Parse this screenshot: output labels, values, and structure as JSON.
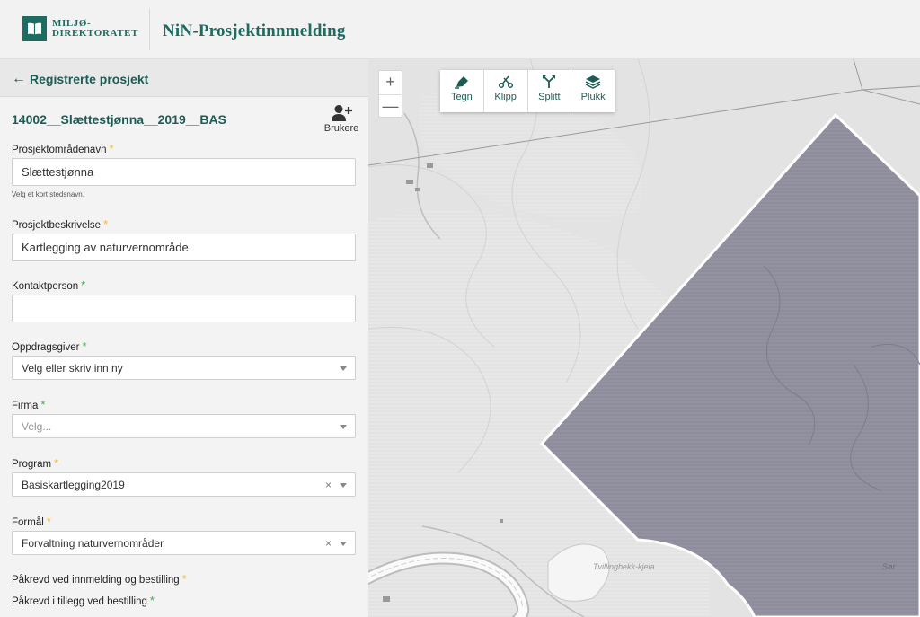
{
  "header": {
    "logo_line1": "MILJØ-",
    "logo_line2": "DIREKTORATET",
    "title": "NiN-Prosjektinnmelding"
  },
  "panel": {
    "back_label": "Registrerte prosjekt",
    "project_title": "14002__Slættestjønna__2019__BAS",
    "users_label": "Brukere",
    "fields": {
      "area_name": {
        "label": "Prosjektområdenavn",
        "value": "Slættestjønna",
        "hint": "Velg et kort stedsnavn."
      },
      "description": {
        "label": "Prosjektbeskrivelse",
        "value": "Kartlegging av naturvernområde"
      },
      "contact": {
        "label": "Kontaktperson",
        "value": ""
      },
      "client": {
        "label": "Oppdragsgiver",
        "value": "Velg eller skriv inn ny"
      },
      "company": {
        "label": "Firma",
        "placeholder": "Velg..."
      },
      "program": {
        "label": "Program",
        "value": "Basiskartlegging2019"
      },
      "purpose": {
        "label": "Formål",
        "value": "Forvaltning naturvernområder"
      }
    },
    "legend_required_registration": "Påkrevd ved innmelding og bestilling",
    "legend_required_ordering": "Påkrevd i tillegg ved bestilling",
    "clear_symbol": "×"
  },
  "map": {
    "zoom_in": "+",
    "zoom_out": "—",
    "tools": [
      {
        "label": "Tegn",
        "icon": "pen-icon"
      },
      {
        "label": "Klipp",
        "icon": "scissors-icon"
      },
      {
        "label": "Splitt",
        "icon": "split-icon"
      },
      {
        "label": "Plukk",
        "icon": "layers-icon"
      }
    ],
    "place_label": "Tvillingbekk-kjela",
    "corner_label": "Sør",
    "colors": {
      "polygon": "#8e8d9c",
      "accent": "#1d6b61",
      "required_optional": "#f2b632",
      "required_order": "#3aab4c"
    }
  }
}
